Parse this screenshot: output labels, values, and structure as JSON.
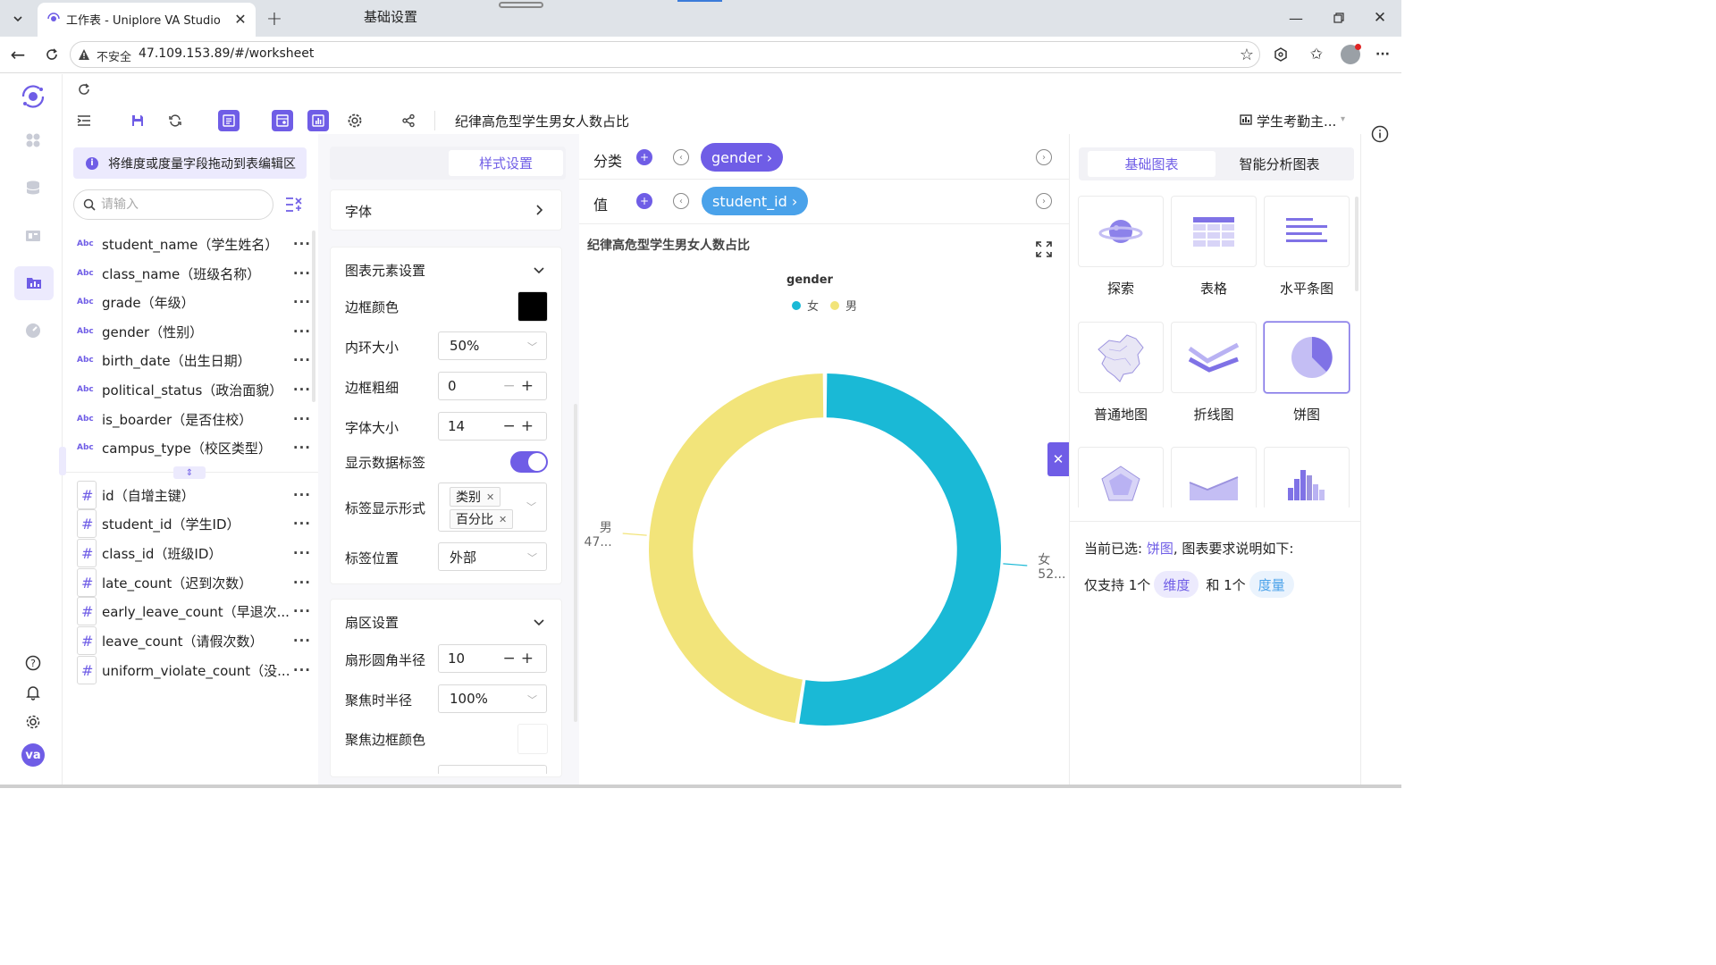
{
  "browser": {
    "tab_title": "工作表 - Uniplore VA Studio",
    "security_label": "不安全",
    "url": "47.109.153.89/#/worksheet"
  },
  "toolbar": {
    "sheet_title": "纪律高危型学生男女人数占比",
    "dataset_name": "学生考勤主..."
  },
  "fields": {
    "hint": "将维度或度量字段拖动到表编辑区",
    "search_placeholder": "请输入",
    "type_text": "Abc",
    "type_num": "#",
    "dimensions": [
      "student_name（学生姓名）",
      "class_name（班级名称）",
      "grade（年级）",
      "gender（性别）",
      "birth_date（出生日期）",
      "political_status（政治面貌）",
      "is_boarder（是否住校）",
      "campus_type（校区类型）"
    ],
    "measures": [
      "id（自增主键）",
      "student_id（学生ID）",
      "class_id（班级ID）",
      "late_count（迟到次数）",
      "early_leave_count（早退次...",
      "leave_count（请假次数）",
      "uniform_violate_count（没..."
    ],
    "more": "···"
  },
  "settings": {
    "tab_basic": "基础设置",
    "tab_style": "样式设置",
    "font_section": "字体",
    "elements_section": "图表元素设置",
    "border_color_label": "边框颜色",
    "border_color": "#000000",
    "inner_radius_label": "内环大小",
    "inner_radius_value": "50%",
    "border_width_label": "边框粗细",
    "border_width_value": "0",
    "font_size_label": "字体大小",
    "font_size_value": "14",
    "show_labels_label": "显示数据标签",
    "show_labels_on": true,
    "label_form_label": "标签显示形式",
    "label_form_tags": [
      "类别",
      "百分比"
    ],
    "label_pos_label": "标签位置",
    "label_pos_value": "外部",
    "sector_section": "扇区设置",
    "corner_radius_label": "扇形圆角半径",
    "corner_radius_value": "10",
    "focus_radius_label": "聚焦时半径",
    "focus_radius_value": "100%",
    "focus_border_label": "聚焦边框颜色"
  },
  "shelf": {
    "category_label": "分类",
    "category_pill": "gender ›",
    "value_label": "值",
    "value_pill": "student_id ›"
  },
  "chart_data": {
    "type": "pie",
    "title": "纪律高危型学生男女人数占比",
    "legend_title": "gender",
    "legend_position": "top",
    "inner_radius_pct": 50,
    "series": [
      {
        "name": "女",
        "value": 52,
        "color": "#1ab9d6",
        "label_value": "52..."
      },
      {
        "name": "男",
        "value": 47,
        "color": "#f2e47a",
        "label_value": "47..."
      }
    ]
  },
  "chart_types": {
    "tab_basic": "基础图表",
    "tab_smart": "智能分析图表",
    "items": [
      "探索",
      "表格",
      "水平条图",
      "普通地图",
      "折线图",
      "饼图"
    ],
    "selected": "饼图",
    "desc_prefix": "当前已选: ",
    "desc_selected": "饼图",
    "desc_suffix": ", 图表要求说明如下:",
    "req_prefix": "仅支持 1个",
    "req_dim": "维度",
    "req_mid": "和 1个",
    "req_measure": "度量"
  },
  "nav": {
    "avatar_text": "va"
  },
  "colors": {
    "accent": "#6f5de6",
    "teal": "#1ab9d6",
    "yellow": "#f2e47a"
  }
}
